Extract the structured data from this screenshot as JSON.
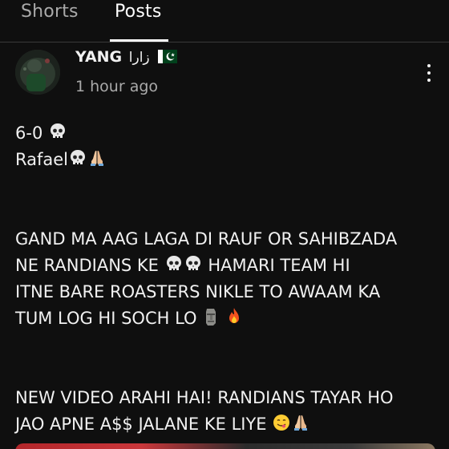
{
  "tabs": [
    {
      "label": "Shorts",
      "active": false
    },
    {
      "label": "Posts",
      "active": true
    }
  ],
  "post": {
    "channel_name": "YANG",
    "channel_suffix": "زارا",
    "flag_icon": "pakistan-flag-icon",
    "timestamp": "1 hour ago",
    "lines": [
      "6-0",
      "Rafael",
      "GAND MA AAG LAGA DI RAUF OR SAHIBZADA",
      "NE RANDIANS KE",
      "HAMARI TEAM HI",
      "ITNE BARE ROASTERS NIKLE TO AWAAM KA",
      "TUM LOG HI SOCH LO",
      "NEW VIDEO ARAHI HAI! RANDIANS TAYAR HO",
      "JAO APNE A$$ JALANE KE LIYE"
    ]
  },
  "colors": {
    "background": "#0f0f0f",
    "text": "#f1f1f1",
    "secondary_text": "#aaaaaa",
    "divider": "#3a3a3a"
  }
}
